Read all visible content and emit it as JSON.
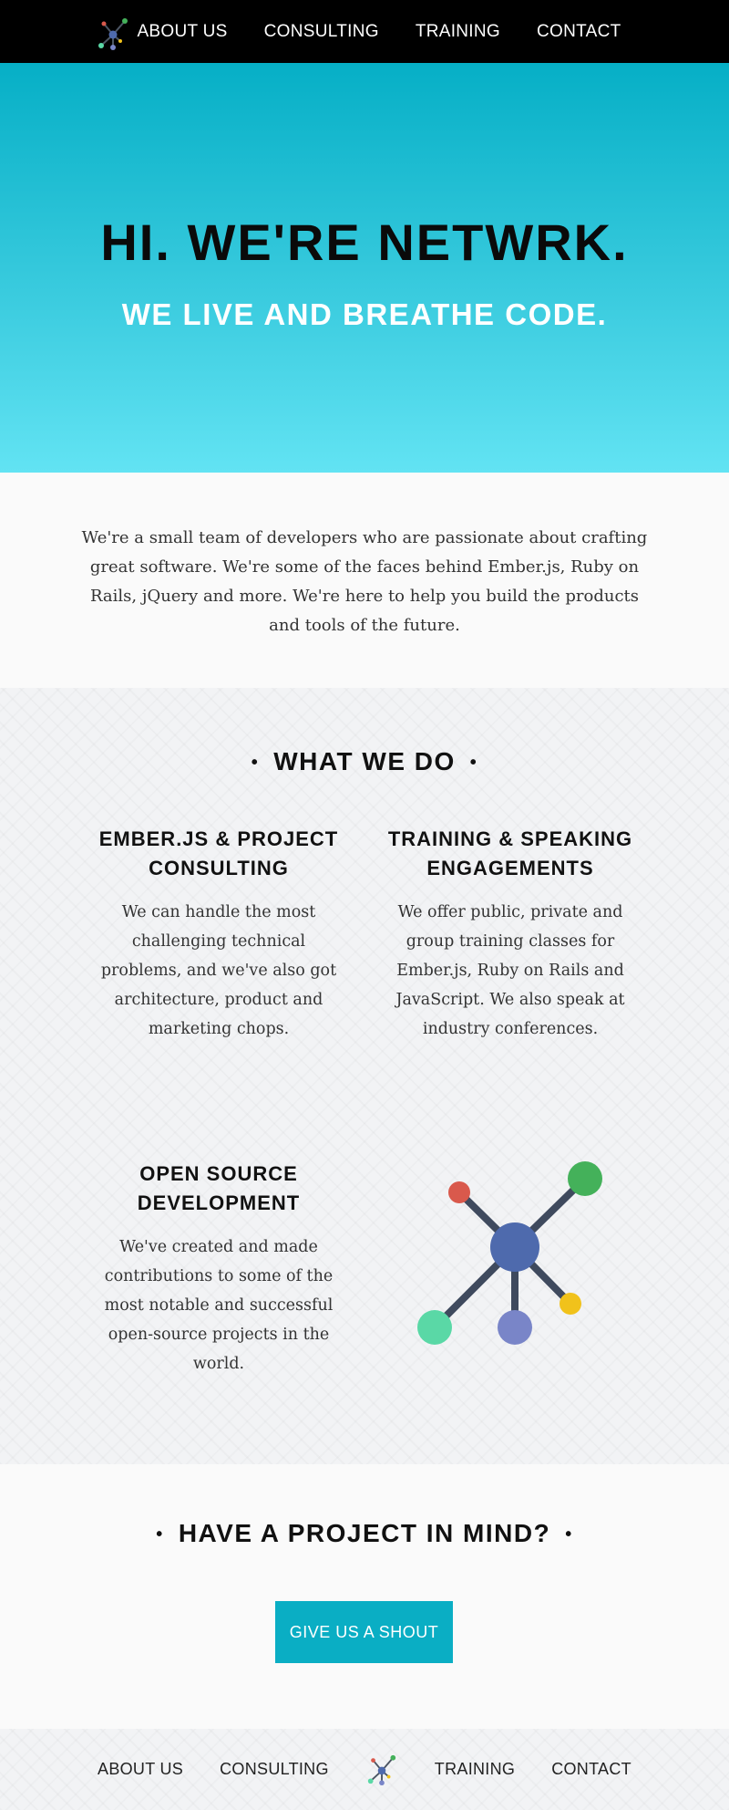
{
  "nav": {
    "logo": "netwrk-logo-icon",
    "items": [
      "ABOUT US",
      "CONSULTING",
      "TRAINING",
      "CONTACT"
    ]
  },
  "hero": {
    "title": "HI. WE'RE NETWRK.",
    "subtitle": "WE LIVE AND BREATHE CODE."
  },
  "intro": {
    "text": "We're a small team of developers who are passionate about crafting great software. We're some of the faces behind Ember.js, Ruby on Rails, jQuery and more. We're here to help you build the products and tools of the future."
  },
  "services": {
    "title": "WHAT WE DO",
    "items": [
      {
        "title": "EMBER.JS & PROJECT CONSULTING",
        "text": "We can handle the most challenging technical problems, and we've also got architecture, product and marketing chops."
      },
      {
        "title": "TRAINING & SPEAKING ENGAGEMENTS",
        "text": "We offer public, private and group training classes for Ember.js, Ruby on Rails and JavaScript. We also speak at industry conferences."
      },
      {
        "title": "OPEN SOURCE DEVELOPMENT",
        "text": "We've created and made contributions to some of the most notable and successful open-source projects in the world."
      }
    ],
    "graphic": "network-graph-icon"
  },
  "cta": {
    "title": "HAVE A PROJECT IN MIND?",
    "button": "GIVE US A SHOUT"
  },
  "footer": {
    "items": [
      "ABOUT US",
      "CONSULTING",
      "TRAINING",
      "CONTACT"
    ],
    "logo": "netwrk-logo-icon"
  },
  "colors": {
    "accent": "#0aaec4",
    "hero_top": "#06afc6",
    "hero_bottom": "#62e3f3",
    "node_center": "#4e6aad",
    "node_red": "#d9594c",
    "node_green": "#44b15a",
    "node_teal": "#5ad8a6",
    "node_purple": "#7985c8",
    "node_yellow": "#f1c21b"
  }
}
